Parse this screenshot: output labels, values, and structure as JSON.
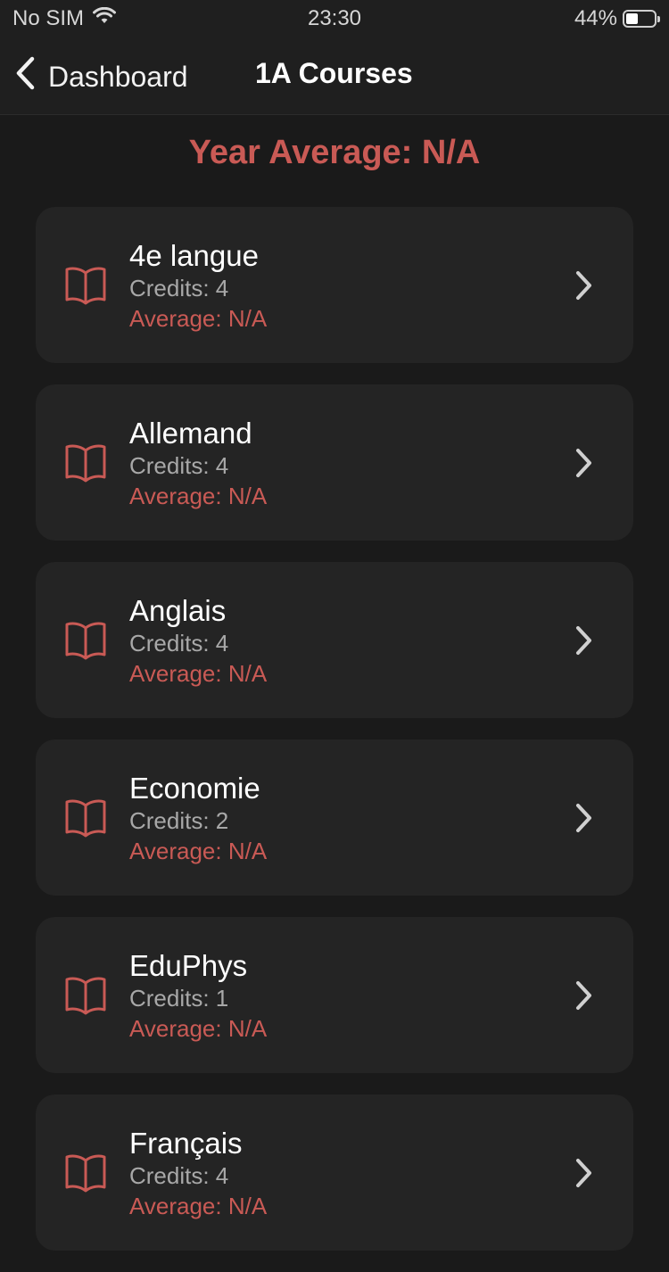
{
  "status": {
    "carrier": "No SIM",
    "time": "23:30",
    "battery": "44%",
    "battery_level": 0.44
  },
  "nav": {
    "back_label": "Dashboard",
    "title": "1A Courses"
  },
  "year_average": {
    "label": "Year Average: N/A"
  },
  "colors": {
    "accent": "#c95a55",
    "background": "#1a1a1a",
    "card": "#242424"
  },
  "courses": [
    {
      "name": "4e langue",
      "credits": "Credits: 4",
      "average": "Average: N/A"
    },
    {
      "name": "Allemand",
      "credits": "Credits: 4",
      "average": "Average: N/A"
    },
    {
      "name": "Anglais",
      "credits": "Credits: 4",
      "average": "Average: N/A"
    },
    {
      "name": "Economie",
      "credits": "Credits: 2",
      "average": "Average: N/A"
    },
    {
      "name": "EduPhys",
      "credits": "Credits: 1",
      "average": "Average: N/A"
    },
    {
      "name": "Français",
      "credits": "Credits: 4",
      "average": "Average: N/A"
    }
  ],
  "icons": {
    "course": "book-icon",
    "disclosure": "chevron-right-icon",
    "back": "chevron-left-icon",
    "wifi": "wifi-icon",
    "battery": "battery-icon"
  }
}
